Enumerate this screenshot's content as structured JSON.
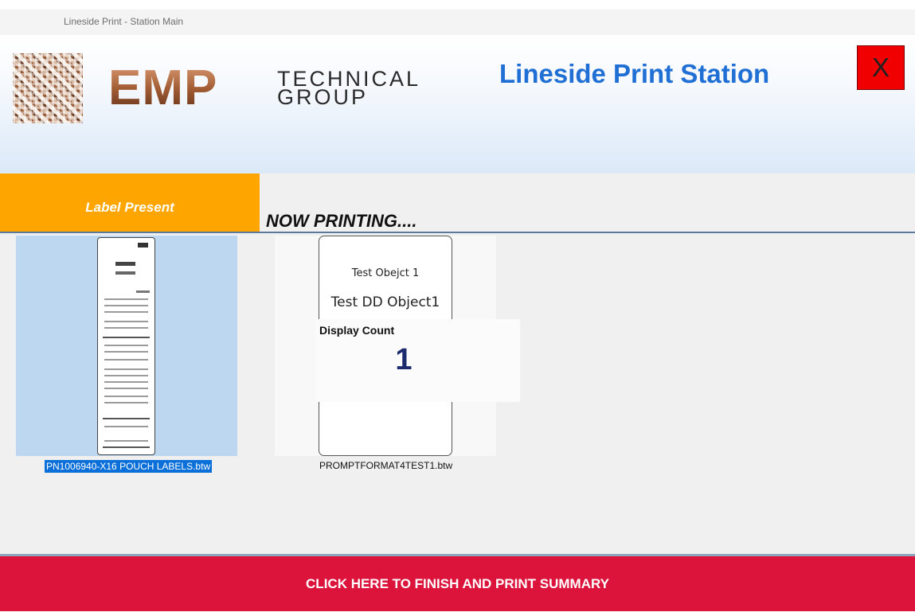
{
  "window": {
    "title": "Lineside Print - Station Main"
  },
  "header": {
    "logo_main": "EMP",
    "logo_sub_line1": "TECHNICAL",
    "logo_sub_line2": "GROUP",
    "app_title": "Lineside Print Station",
    "close_label": "X"
  },
  "status": {
    "label_present": "Label Present",
    "now_printing": "NOW PRINTING...."
  },
  "labels": [
    {
      "filename": "PN1006940-X16 POUCH LABELS.btw",
      "selected": true
    },
    {
      "filename": "PROMPTFORMAT4TEST1.btw",
      "selected": false,
      "preview_lines": [
        "Test Obejct 1",
        "Test DD Object1"
      ]
    }
  ],
  "display_count": {
    "label": "Display Count",
    "value": "1"
  },
  "footer": {
    "finish_button": "CLICK HERE TO FINISH AND PRINT SUMMARY"
  },
  "colors": {
    "accent_orange": "#ffa500",
    "finish_red": "#dc143c",
    "close_red": "#f00000",
    "title_blue": "#1f6fd4",
    "selection_blue": "#0a6fd8"
  }
}
